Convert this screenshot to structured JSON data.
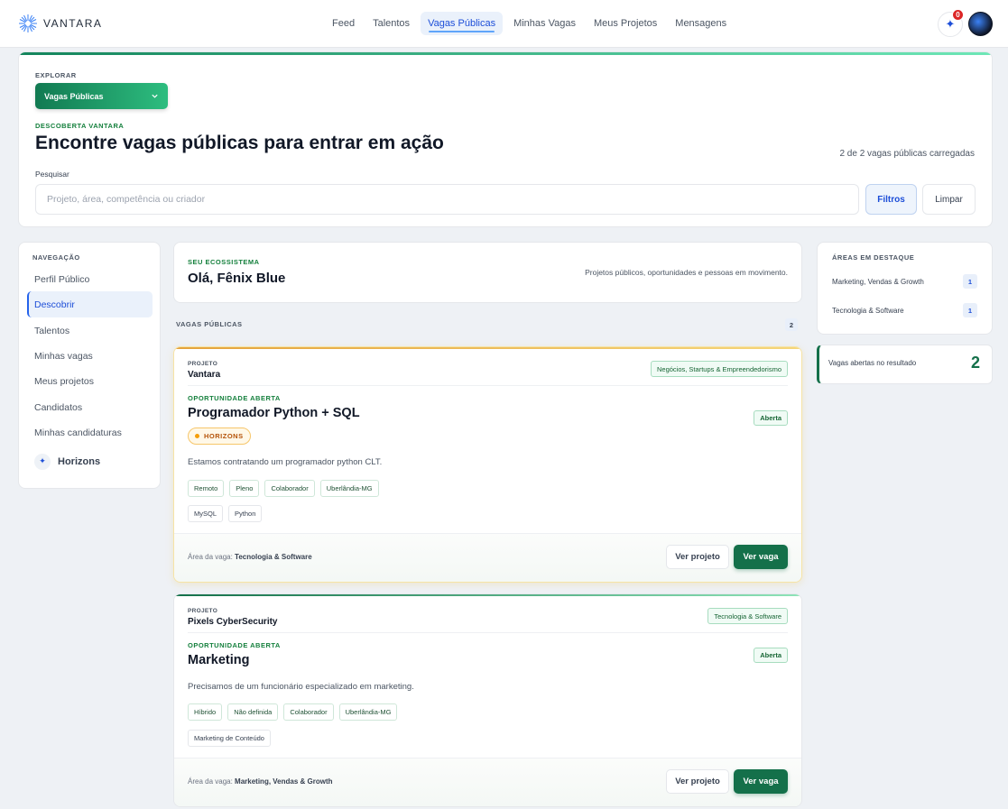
{
  "brand": {
    "name": "VANTARA"
  },
  "nav": {
    "items": [
      "Feed",
      "Talentos",
      "Vagas Públicas",
      "Minhas Vagas",
      "Meus Projetos",
      "Mensagens"
    ],
    "active": "Vagas Públicas",
    "notifications": "0",
    "spark_icon": "sparkle-icon"
  },
  "hero": {
    "explore_label": "EXPLORAR",
    "explore_value": "Vagas Públicas",
    "eyebrow": "DESCOBERTA VANTARA",
    "title": "Encontre vagas públicas para entrar em ação",
    "count_text": "2 de 2 vagas públicas carregadas",
    "search_label": "Pesquisar",
    "search_placeholder": "Projeto, área, competência ou criador",
    "search_value": "",
    "filters_label": "Filtros",
    "clear_label": "Limpar"
  },
  "sidebar": {
    "title": "NAVEGAÇÃO",
    "items": [
      "Perfil Público",
      "Descobrir",
      "Talentos",
      "Minhas vagas",
      "Meus projetos",
      "Candidatos",
      "Minhas candidaturas"
    ],
    "active": "Descobrir",
    "horizons_label": "Horizons"
  },
  "greeting": {
    "eyebrow": "SEU ECOSSISTEMA",
    "title": "Olá, Fênix Blue",
    "desc": "Projetos públicos, oportunidades e pessoas em movimento."
  },
  "list": {
    "header": "VAGAS PÚBLICAS",
    "count": "2"
  },
  "jobs": [
    {
      "project_eyebrow": "PROJETO",
      "project_name": "Vantara",
      "area_tag": "Negócios, Startups & Empreendedorismo",
      "opp_eyebrow": "OPORTUNIDADE ABERTA",
      "title": "Programador Python + SQL",
      "status": "Aberta",
      "horizons": "HORIZONS",
      "description": "Estamos contratando um programador python CLT.",
      "tags": [
        "Remoto",
        "Pleno",
        "Colaborador",
        "Uberlândia-MG"
      ],
      "skills": [
        "MySQL",
        "Python"
      ],
      "area_prefix": "Área da vaga:",
      "area_value": "Tecnologia & Software",
      "btn_project": "Ver projeto",
      "btn_job": "Ver vaga"
    },
    {
      "project_eyebrow": "PROJETO",
      "project_name": "Pixels CyberSecurity",
      "area_tag": "Tecnologia & Software",
      "opp_eyebrow": "OPORTUNIDADE ABERTA",
      "title": "Marketing",
      "status": "Aberta",
      "description": "Precisamos de um funcionário especializado em marketing.",
      "tags": [
        "Híbrido",
        "Não definida",
        "Colaborador",
        "Uberlândia-MG"
      ],
      "skills": [
        "Marketing de Conteúdo"
      ],
      "area_prefix": "Área da vaga:",
      "area_value": "Marketing, Vendas & Growth",
      "btn_project": "Ver projeto",
      "btn_job": "Ver vaga"
    }
  ],
  "featured_areas": {
    "title": "ÁREAS EM DESTAQUE",
    "items": [
      {
        "name": "Marketing, Vendas & Growth",
        "count": "1"
      },
      {
        "name": "Tecnologia & Software",
        "count": "1"
      }
    ]
  },
  "open_jobs": {
    "label": "Vagas abertas no resultado",
    "value": "2"
  },
  "colors": {
    "brand_green": "#14704a",
    "accent_blue": "#1d4ed8",
    "horizons_amber": "#f59e0b"
  }
}
